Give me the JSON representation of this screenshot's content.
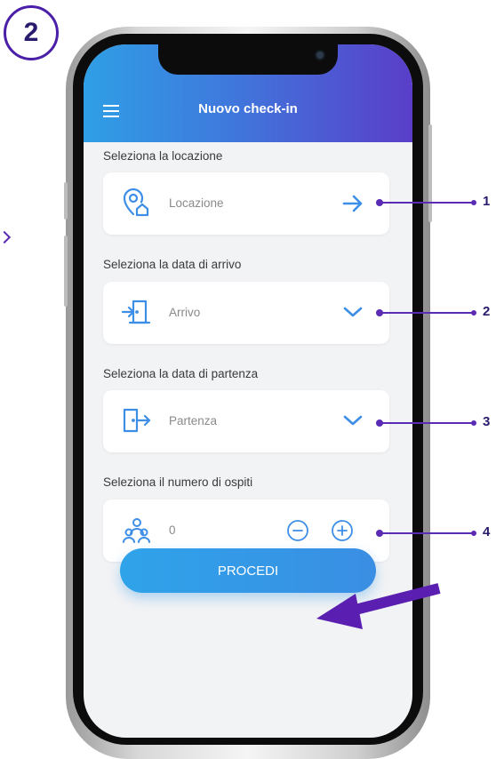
{
  "step_badge": "2",
  "colors": {
    "accent_purple": "#5a2bb5",
    "appbar_start": "#2f9fe6",
    "appbar_end": "#5a3ec9",
    "icon_blue": "#3d8ee6",
    "button_blue": "#2fa3ea"
  },
  "app": {
    "title": "Nuovo check-in",
    "menu_icon": "hamburger-menu-icon"
  },
  "location": {
    "section_label": "Seleziona la locazione",
    "placeholder": "Locazione",
    "icon": "location-home-icon",
    "action_icon": "arrow-right-icon"
  },
  "arrival": {
    "section_label": "Seleziona la data di arrivo",
    "placeholder": "Arrivo",
    "icon": "door-enter-icon",
    "action_icon": "chevron-down-icon"
  },
  "departure": {
    "section_label": "Seleziona la data di partenza",
    "placeholder": "Partenza",
    "icon": "door-exit-icon",
    "action_icon": "chevron-down-icon"
  },
  "guests": {
    "section_label": "Seleziona il numero di ospiti",
    "value": "0",
    "icon": "guests-icon",
    "decrement_icon": "minus-circle-icon",
    "increment_icon": "plus-circle-icon"
  },
  "proceed_button": "PROCEDI",
  "callouts": [
    "1",
    "2",
    "3",
    "4"
  ]
}
